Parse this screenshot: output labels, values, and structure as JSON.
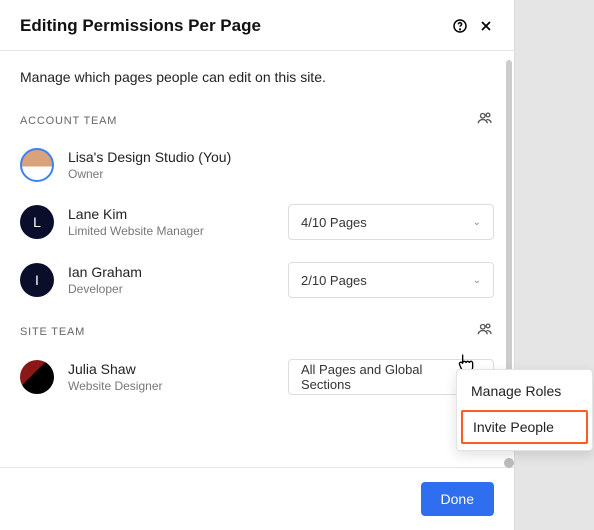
{
  "header": {
    "title": "Editing Permissions Per Page"
  },
  "description": "Manage which pages people can edit on this site.",
  "sections": {
    "account_team_label": "ACCOUNT TEAM",
    "site_team_label": "SITE TEAM"
  },
  "members": {
    "lisa": {
      "name": "Lisa's Design Studio (You)",
      "role": "Owner"
    },
    "lane": {
      "name": "Lane Kim",
      "role": "Limited Website Manager",
      "pages": "4/10 Pages"
    },
    "ian": {
      "name": "Ian Graham",
      "role": "Developer",
      "pages": "2/10 Pages"
    },
    "julia": {
      "name": "Julia Shaw",
      "role": "Website Designer",
      "pages": "All Pages and Global Sections"
    }
  },
  "menu": {
    "manage_roles": "Manage Roles",
    "invite_people": "Invite People"
  },
  "footer": {
    "done": "Done"
  }
}
